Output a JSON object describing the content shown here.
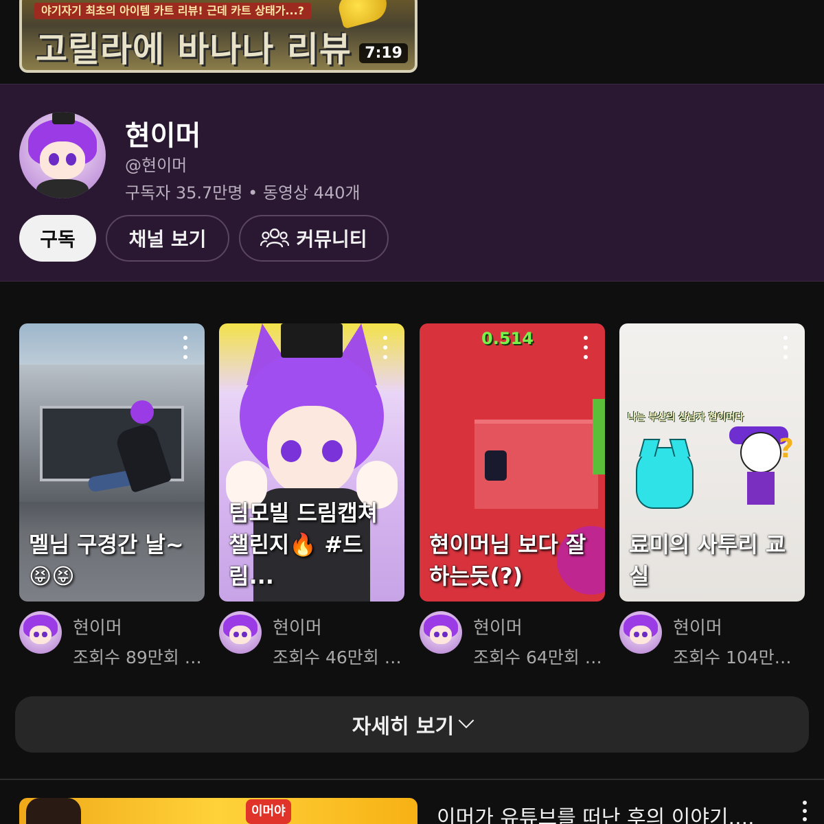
{
  "top_video": {
    "banner_text": "야기자기 최초의 아이템 카트 리뷰! 근데 카트 상태가...?",
    "headline": "고릴라에 바나나 리뷰",
    "duration": "7:19"
  },
  "channel": {
    "name": "현이머",
    "handle": "@현이머",
    "stats": "구독자 35.7만명 • 동영상 440개",
    "subscribe_label": "구독",
    "view_channel_label": "채널 보기",
    "community_label": "커뮤니티"
  },
  "shorts": [
    {
      "caption": "멜님 구경간 날~😝😝",
      "channel": "현이머",
      "views": "조회수 89만회 · ..."
    },
    {
      "caption": "팀모빌 드림캡쳐 챌린지🔥 #드림...",
      "channel": "현이머",
      "views": "조회수 46만회 · ..."
    },
    {
      "caption": "현이머님 보다 잘하는듯(?)",
      "channel": "현이머",
      "views": "조회수 64만회 · ...",
      "overlay": "0.514"
    },
    {
      "caption": "료미의 사투리 교실",
      "channel": "현이머",
      "views": "조회수 104만회...",
      "overlay": "나는 부산의 상남자 현이머다"
    }
  ],
  "more_label": "자세히 보기",
  "next_video": {
    "title": "이머가 유튜브를 떠난 후의 이야기....",
    "tag": "이머야"
  },
  "colors": {
    "background": "#0f0f0f",
    "channel_bg": "#2a1832",
    "accent_purple": "#9b3be6"
  }
}
